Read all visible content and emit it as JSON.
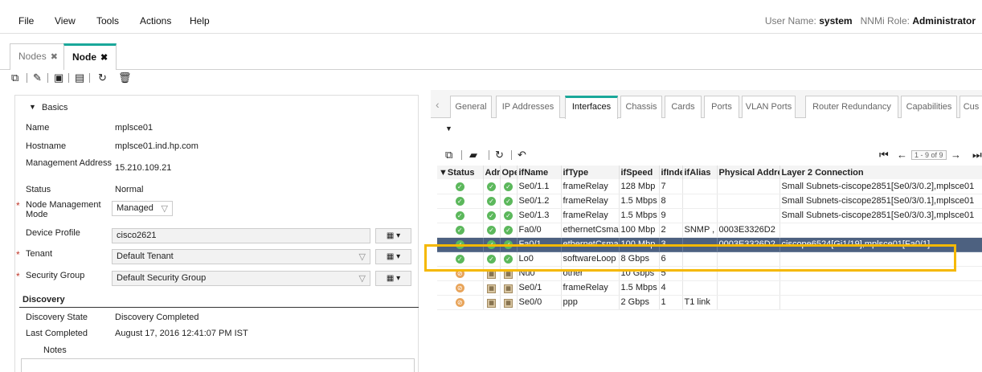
{
  "menu": {
    "file": "File",
    "view": "View",
    "tools": "Tools",
    "actions": "Actions",
    "help": "Help"
  },
  "user": {
    "name_label": "User Name:",
    "name": "system",
    "role_label": "NNMi Role:",
    "role": "Administrator"
  },
  "tabs": [
    {
      "label": "Nodes",
      "close": "✖"
    },
    {
      "label": "Node",
      "close": "✖"
    }
  ],
  "basics": {
    "header": "Basics",
    "name_label": "Name",
    "name": "mplsce01",
    "hostname_label": "Hostname",
    "hostname": "mplsce01.ind.hp.com",
    "mgmt_addr_label": "Management Address",
    "mgmt_addr": "15.210.109.21",
    "status_label": "Status",
    "status": "Normal",
    "nmm_label": "Node Management Mode",
    "nmm": "Managed",
    "device_profile_label": "Device Profile",
    "device_profile": "cisco2621",
    "tenant_label": "Tenant",
    "tenant": "Default Tenant",
    "security_group_label": "Security Group",
    "security_group": "Default Security Group"
  },
  "discovery": {
    "header": "Discovery",
    "state_label": "Discovery State",
    "state": "Discovery Completed",
    "last_label": "Last Completed",
    "last": "August 17, 2016 12:41:07 PM IST",
    "notes_label": "Notes"
  },
  "right_tabs": [
    "General",
    "IP Addresses",
    "Interfaces",
    "Chassis",
    "Cards",
    "Ports",
    "VLAN Ports",
    "Router Redundancy",
    "Capabilities",
    "Cus"
  ],
  "pager": "1 - 9 of 9",
  "table": {
    "headers": [
      "▼Status",
      "Adr",
      "Ope",
      "ifName",
      "ifType",
      "ifSpeed",
      "ifInde",
      "ifAlias",
      "Physical Addre",
      "Layer 2 Connection"
    ],
    "rows": [
      {
        "status": "ok",
        "adm": "ok",
        "op": "ok",
        "ifName": "Se0/1.1",
        "ifType": "frameRelay",
        "ifSpeed": "128 Mbp",
        "ifIndex": "7",
        "ifAlias": "",
        "phys": "",
        "l2": "Small Subnets-ciscope2851[Se0/3/0.2],mplsce01"
      },
      {
        "status": "ok",
        "adm": "ok",
        "op": "ok",
        "ifName": "Se0/1.2",
        "ifType": "frameRelay",
        "ifSpeed": "1.5 Mbps",
        "ifIndex": "8",
        "ifAlias": "",
        "phys": "",
        "l2": "Small Subnets-ciscope2851[Se0/3/0.1],mplsce01"
      },
      {
        "status": "ok",
        "adm": "ok",
        "op": "ok",
        "ifName": "Se0/1.3",
        "ifType": "frameRelay",
        "ifSpeed": "1.5 Mbps",
        "ifIndex": "9",
        "ifAlias": "",
        "phys": "",
        "l2": "Small Subnets-ciscope2851[Se0/3/0.3],mplsce01"
      },
      {
        "status": "ok",
        "adm": "ok",
        "op": "ok",
        "ifName": "Fa0/0",
        "ifType": "ethernetCsma",
        "ifSpeed": "100 Mbp",
        "ifIndex": "2",
        "ifAlias": "SNMP ,",
        "phys": "0003E3326D2",
        "l2": ""
      },
      {
        "status": "ok",
        "adm": "ok",
        "op": "ok",
        "ifName": "Fa0/1",
        "ifType": "ethernetCsma",
        "ifSpeed": "100 Mbp",
        "ifIndex": "3",
        "ifAlias": "",
        "phys": "0003E3326D2",
        "l2": "ciscope6524[Gi1/19],mplsce01[Fa0/1]"
      },
      {
        "status": "ok",
        "adm": "ok",
        "op": "ok",
        "ifName": "Lo0",
        "ifType": "softwareLoop",
        "ifSpeed": "8 Gbps",
        "ifIndex": "6",
        "ifAlias": "",
        "phys": "",
        "l2": ""
      },
      {
        "status": "unk",
        "adm": "adm",
        "op": "adm",
        "ifName": "Nu0",
        "ifType": "other",
        "ifSpeed": "10 Gbps",
        "ifIndex": "5",
        "ifAlias": "",
        "phys": "",
        "l2": ""
      },
      {
        "status": "unk",
        "adm": "adm",
        "op": "adm",
        "ifName": "Se0/1",
        "ifType": "frameRelay",
        "ifSpeed": "1.5 Mbps",
        "ifIndex": "4",
        "ifAlias": "",
        "phys": "",
        "l2": ""
      },
      {
        "status": "unk",
        "adm": "adm",
        "op": "adm",
        "ifName": "Se0/0",
        "ifType": "ppp",
        "ifSpeed": "2 Gbps",
        "ifIndex": "1",
        "ifAlias": "T1 link",
        "phys": "",
        "l2": ""
      }
    ]
  },
  "colors": {
    "accent": "#1aa89a",
    "selected_row": "#4d6180",
    "highlight": "#f5b800",
    "status_ok": "#5cb85c",
    "status_unknown": "#e8a45a"
  },
  "icons": {
    "toolbar": [
      "open-icon",
      "edit-icon",
      "save-icon",
      "save-close-icon",
      "refresh-icon",
      "delete-icon"
    ],
    "table_toolbar": [
      "open-icon",
      "folder-icon",
      "refresh-icon",
      "undo-icon"
    ]
  }
}
